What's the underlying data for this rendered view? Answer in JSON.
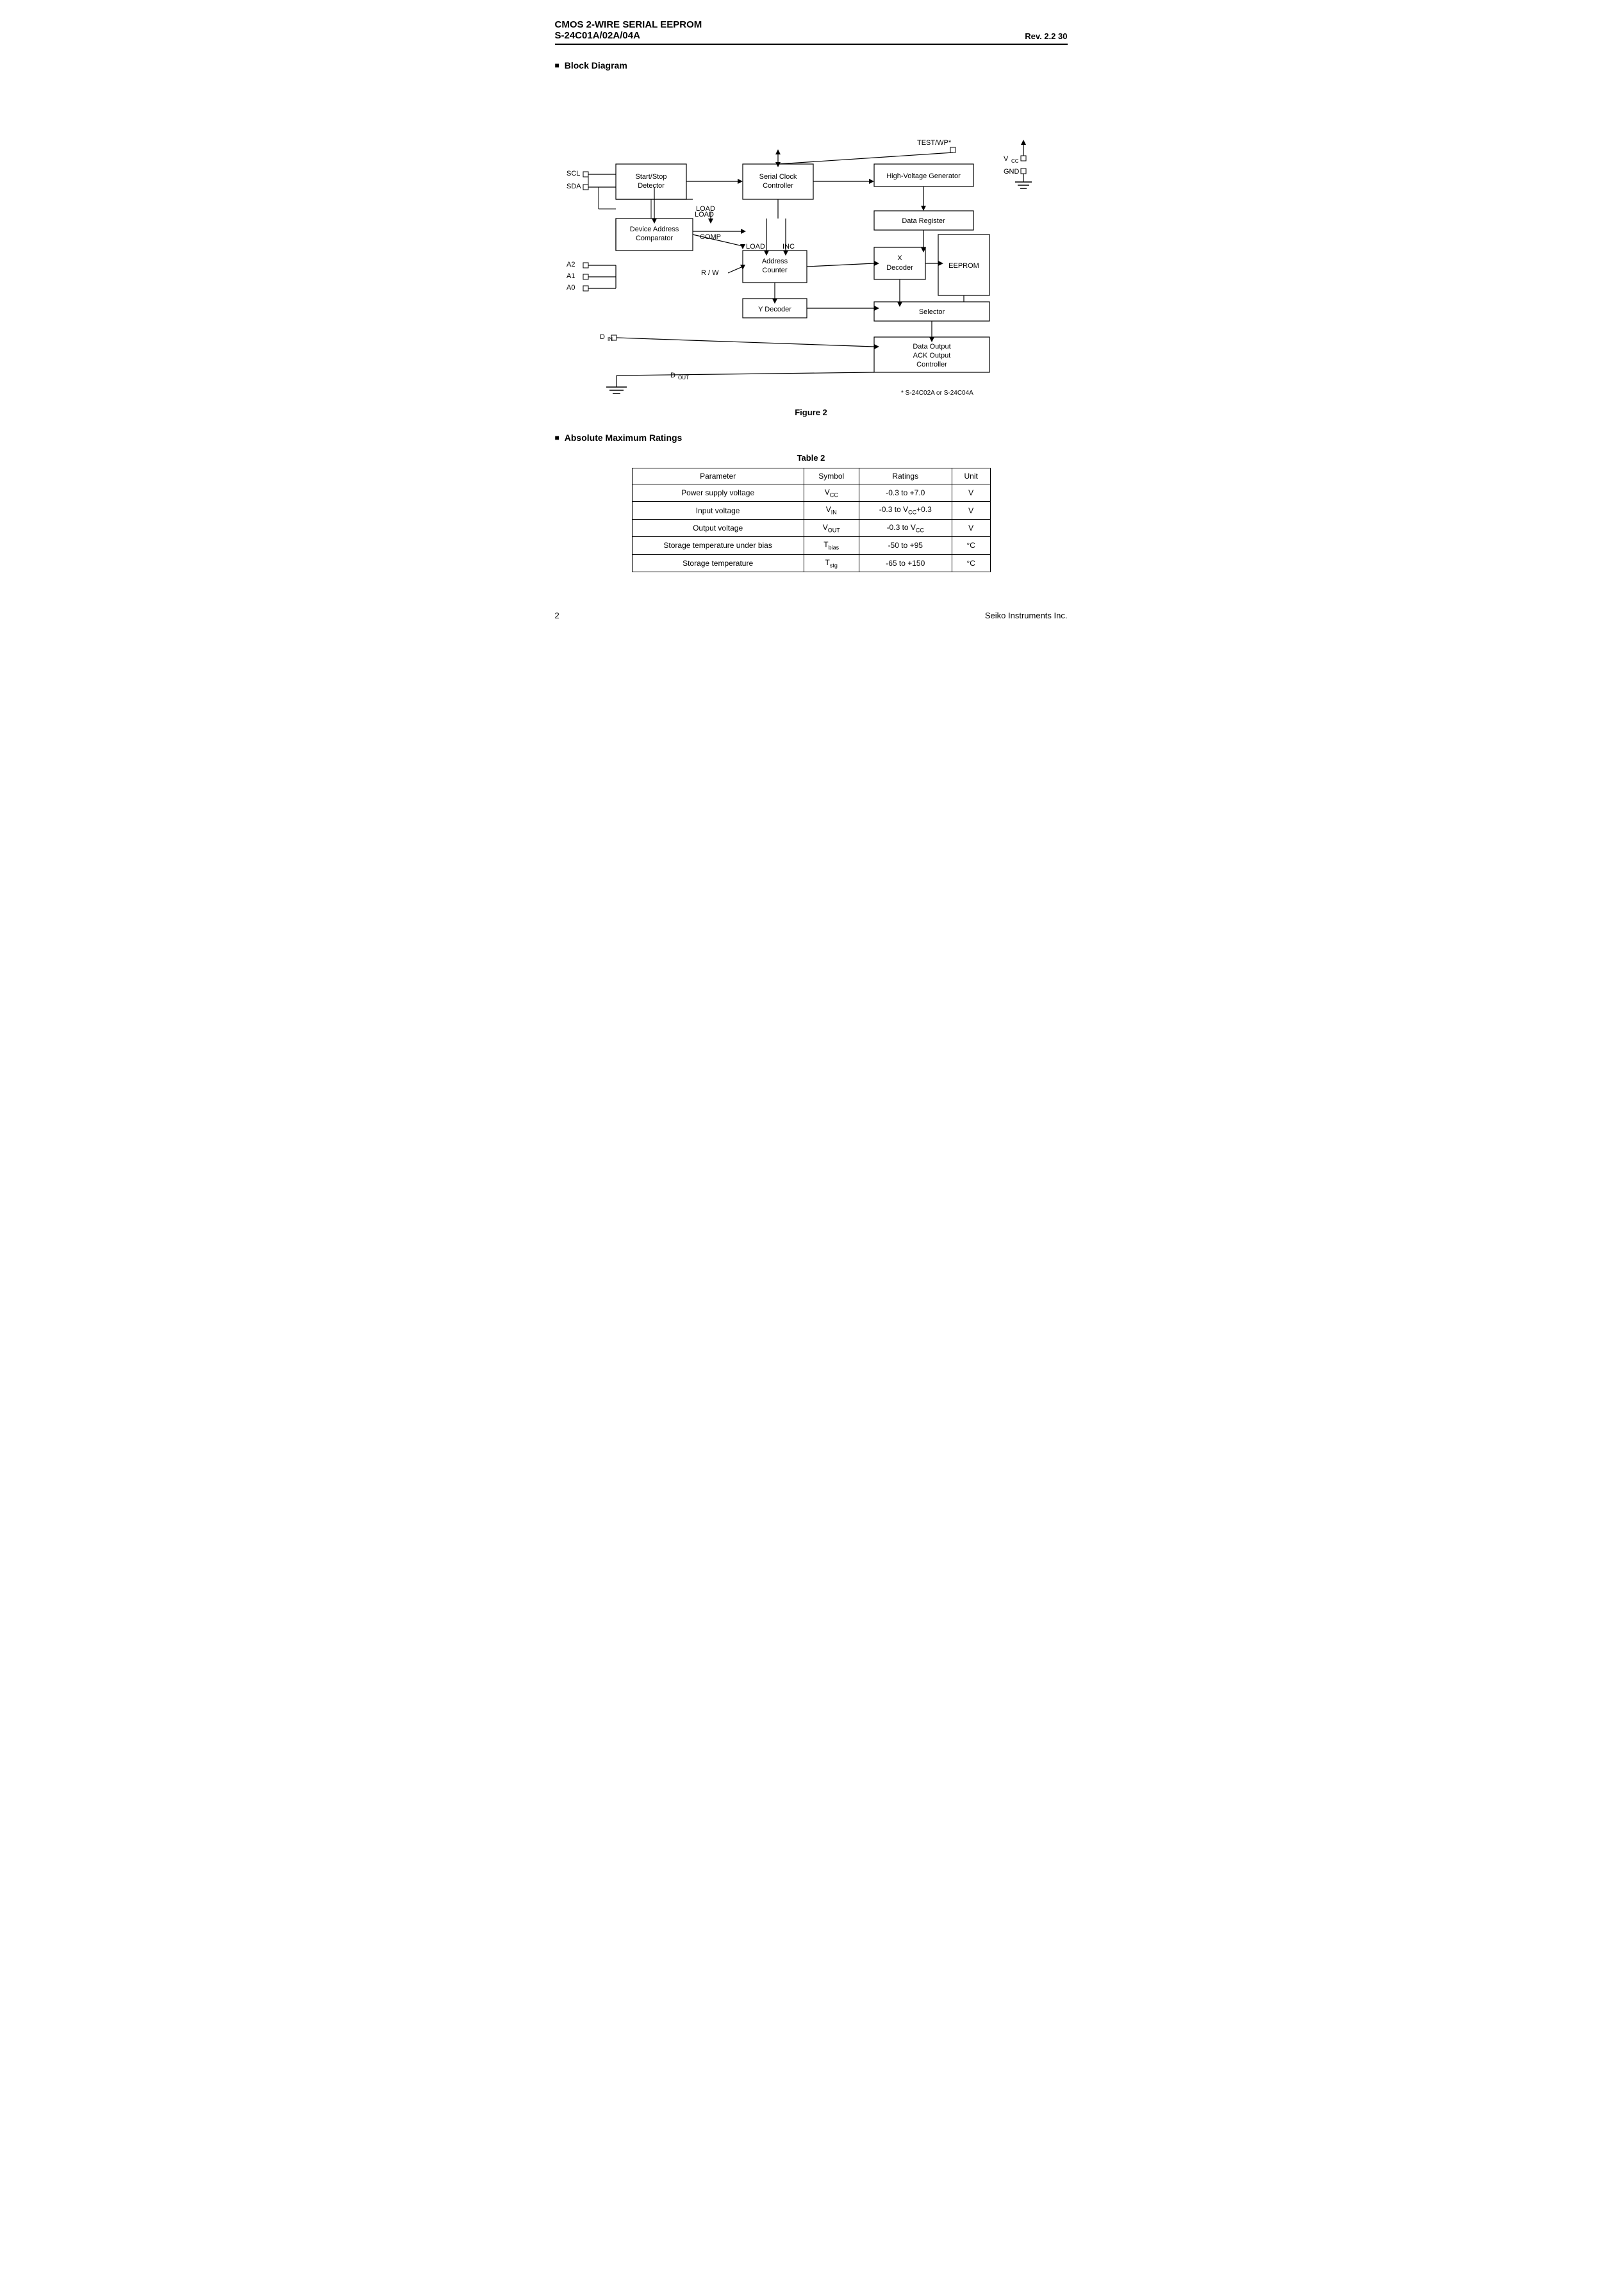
{
  "header": {
    "title_main": "CMOS 2-WIRE SERIAL  EEPROM",
    "title_sub": "S-24C01A/02A/04A",
    "rev": "Rev. 2.2  30"
  },
  "block_diagram": {
    "section_label": "Block Diagram",
    "figure_caption": "Figure 2",
    "footnote": "*   S-24C02A or S-24C04A",
    "blocks": {
      "start_stop": "Start/Stop\nDetector",
      "serial_clock": "Serial Clock\nController",
      "high_voltage": "High-Voltage Generator",
      "device_address": "Device Address\nComparator",
      "address_counter": "Address\nCounter",
      "data_register": "Data Register",
      "x_decoder": "X\nDecoder",
      "eeprom": "EEPROM",
      "y_decoder": "Y Decoder",
      "selector": "Selector",
      "data_output": "Data Output\nACK Output\nController"
    },
    "signals": {
      "scl": "SCL",
      "sda": "SDA",
      "a2": "A2",
      "a1": "A1",
      "a0": "A0",
      "din": "D",
      "din_sub": "IN",
      "dout": "D",
      "dout_sub": "OUT",
      "vcc": "V",
      "vcc_sub": "CC",
      "gnd": "GND",
      "test_wp": "TEST/WP*",
      "load": "LOAD",
      "comp": "COMP",
      "load2": "LOAD",
      "inc": "INC",
      "rw": "R / W"
    }
  },
  "table": {
    "title": "Table  2",
    "columns": [
      "Parameter",
      "Symbol",
      "Ratings",
      "Unit"
    ],
    "rows": [
      {
        "parameter": "Power supply voltage",
        "symbol": "V_CC",
        "ratings": "-0.3 to +7.0",
        "unit": "V"
      },
      {
        "parameter": "Input voltage",
        "symbol": "V_IN",
        "ratings": "-0.3 to V_CC+0.3",
        "unit": "V"
      },
      {
        "parameter": "Output voltage",
        "symbol": "V_OUT",
        "ratings": "-0.3 to V_CC",
        "unit": "V"
      },
      {
        "parameter": "Storage temperature under bias",
        "symbol": "T_bias",
        "ratings": "-50 to +95",
        "unit": "°C"
      },
      {
        "parameter": "Storage temperature",
        "symbol": "T_stg",
        "ratings": "-65 to +150",
        "unit": "°C"
      }
    ]
  },
  "footer": {
    "page_number": "2",
    "company": "Seiko Instruments Inc."
  }
}
